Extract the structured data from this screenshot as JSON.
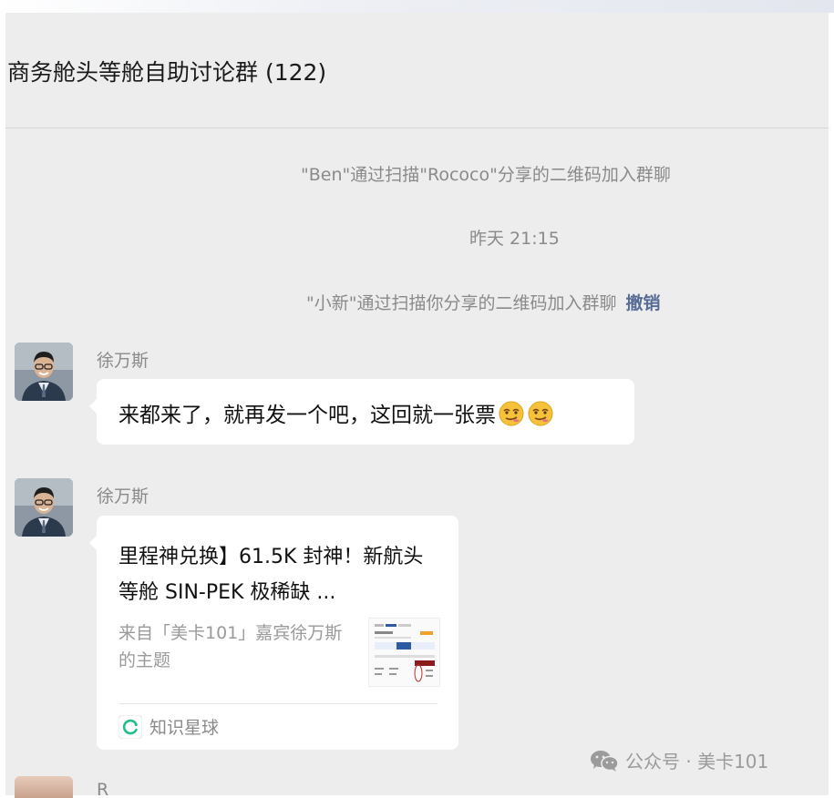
{
  "chat": {
    "title": "商务舱头等舱自助讨论群 (122)"
  },
  "system_messages": [
    {
      "text": "\"Ben\"通过扫描\"Rococo\"分享的二维码加入群聊"
    },
    {
      "text": "昨天 21:15"
    },
    {
      "text": "\"小新\"通过扫描你分享的二维码加入群聊",
      "action": "撤销"
    }
  ],
  "messages": [
    {
      "sender": "徐万斯",
      "text": "来都来了，就再发一个吧，这回就一张票",
      "emoji": [
        "smirk-emoji",
        "smirk-emoji"
      ]
    },
    {
      "sender": "徐万斯",
      "card": {
        "title": "里程神兑换】61.5K 封神！新航头等舱 SIN-PEK 极稀缺 ...",
        "desc": "来自「美卡101」嘉宾徐万斯的主题",
        "source": "知识星球",
        "source_icon": "zsxq-logo-icon"
      }
    }
  ],
  "next_message": {
    "sender_partial": "R"
  },
  "watermark": {
    "text": "公众号 · 美卡101",
    "icon": "wechat-icon"
  },
  "colors": {
    "background": "#ededed",
    "bubble": "#ffffff",
    "link": "#576b95",
    "accent_green": "#07c160"
  }
}
